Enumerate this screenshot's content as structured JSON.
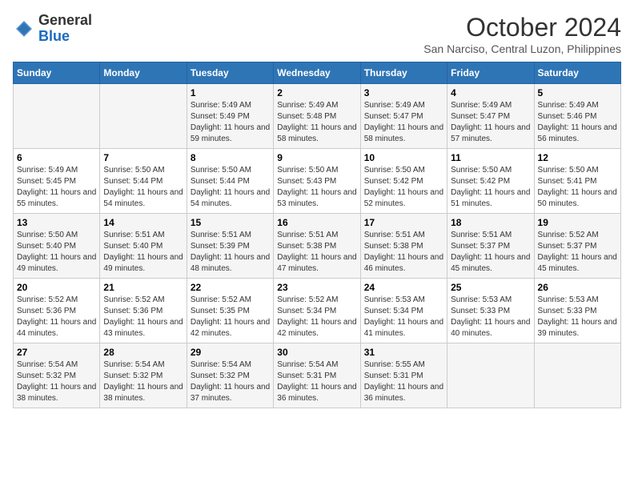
{
  "header": {
    "logo_general": "General",
    "logo_blue": "Blue",
    "month_title": "October 2024",
    "location": "San Narciso, Central Luzon, Philippines"
  },
  "days_of_week": [
    "Sunday",
    "Monday",
    "Tuesday",
    "Wednesday",
    "Thursday",
    "Friday",
    "Saturday"
  ],
  "weeks": [
    [
      {
        "day": "",
        "sunrise": "",
        "sunset": "",
        "daylight": ""
      },
      {
        "day": "",
        "sunrise": "",
        "sunset": "",
        "daylight": ""
      },
      {
        "day": "1",
        "sunrise": "Sunrise: 5:49 AM",
        "sunset": "Sunset: 5:49 PM",
        "daylight": "Daylight: 11 hours and 59 minutes."
      },
      {
        "day": "2",
        "sunrise": "Sunrise: 5:49 AM",
        "sunset": "Sunset: 5:48 PM",
        "daylight": "Daylight: 11 hours and 58 minutes."
      },
      {
        "day": "3",
        "sunrise": "Sunrise: 5:49 AM",
        "sunset": "Sunset: 5:47 PM",
        "daylight": "Daylight: 11 hours and 58 minutes."
      },
      {
        "day": "4",
        "sunrise": "Sunrise: 5:49 AM",
        "sunset": "Sunset: 5:47 PM",
        "daylight": "Daylight: 11 hours and 57 minutes."
      },
      {
        "day": "5",
        "sunrise": "Sunrise: 5:49 AM",
        "sunset": "Sunset: 5:46 PM",
        "daylight": "Daylight: 11 hours and 56 minutes."
      }
    ],
    [
      {
        "day": "6",
        "sunrise": "Sunrise: 5:49 AM",
        "sunset": "Sunset: 5:45 PM",
        "daylight": "Daylight: 11 hours and 55 minutes."
      },
      {
        "day": "7",
        "sunrise": "Sunrise: 5:50 AM",
        "sunset": "Sunset: 5:44 PM",
        "daylight": "Daylight: 11 hours and 54 minutes."
      },
      {
        "day": "8",
        "sunrise": "Sunrise: 5:50 AM",
        "sunset": "Sunset: 5:44 PM",
        "daylight": "Daylight: 11 hours and 54 minutes."
      },
      {
        "day": "9",
        "sunrise": "Sunrise: 5:50 AM",
        "sunset": "Sunset: 5:43 PM",
        "daylight": "Daylight: 11 hours and 53 minutes."
      },
      {
        "day": "10",
        "sunrise": "Sunrise: 5:50 AM",
        "sunset": "Sunset: 5:42 PM",
        "daylight": "Daylight: 11 hours and 52 minutes."
      },
      {
        "day": "11",
        "sunrise": "Sunrise: 5:50 AM",
        "sunset": "Sunset: 5:42 PM",
        "daylight": "Daylight: 11 hours and 51 minutes."
      },
      {
        "day": "12",
        "sunrise": "Sunrise: 5:50 AM",
        "sunset": "Sunset: 5:41 PM",
        "daylight": "Daylight: 11 hours and 50 minutes."
      }
    ],
    [
      {
        "day": "13",
        "sunrise": "Sunrise: 5:50 AM",
        "sunset": "Sunset: 5:40 PM",
        "daylight": "Daylight: 11 hours and 49 minutes."
      },
      {
        "day": "14",
        "sunrise": "Sunrise: 5:51 AM",
        "sunset": "Sunset: 5:40 PM",
        "daylight": "Daylight: 11 hours and 49 minutes."
      },
      {
        "day": "15",
        "sunrise": "Sunrise: 5:51 AM",
        "sunset": "Sunset: 5:39 PM",
        "daylight": "Daylight: 11 hours and 48 minutes."
      },
      {
        "day": "16",
        "sunrise": "Sunrise: 5:51 AM",
        "sunset": "Sunset: 5:38 PM",
        "daylight": "Daylight: 11 hours and 47 minutes."
      },
      {
        "day": "17",
        "sunrise": "Sunrise: 5:51 AM",
        "sunset": "Sunset: 5:38 PM",
        "daylight": "Daylight: 11 hours and 46 minutes."
      },
      {
        "day": "18",
        "sunrise": "Sunrise: 5:51 AM",
        "sunset": "Sunset: 5:37 PM",
        "daylight": "Daylight: 11 hours and 45 minutes."
      },
      {
        "day": "19",
        "sunrise": "Sunrise: 5:52 AM",
        "sunset": "Sunset: 5:37 PM",
        "daylight": "Daylight: 11 hours and 45 minutes."
      }
    ],
    [
      {
        "day": "20",
        "sunrise": "Sunrise: 5:52 AM",
        "sunset": "Sunset: 5:36 PM",
        "daylight": "Daylight: 11 hours and 44 minutes."
      },
      {
        "day": "21",
        "sunrise": "Sunrise: 5:52 AM",
        "sunset": "Sunset: 5:36 PM",
        "daylight": "Daylight: 11 hours and 43 minutes."
      },
      {
        "day": "22",
        "sunrise": "Sunrise: 5:52 AM",
        "sunset": "Sunset: 5:35 PM",
        "daylight": "Daylight: 11 hours and 42 minutes."
      },
      {
        "day": "23",
        "sunrise": "Sunrise: 5:52 AM",
        "sunset": "Sunset: 5:34 PM",
        "daylight": "Daylight: 11 hours and 42 minutes."
      },
      {
        "day": "24",
        "sunrise": "Sunrise: 5:53 AM",
        "sunset": "Sunset: 5:34 PM",
        "daylight": "Daylight: 11 hours and 41 minutes."
      },
      {
        "day": "25",
        "sunrise": "Sunrise: 5:53 AM",
        "sunset": "Sunset: 5:33 PM",
        "daylight": "Daylight: 11 hours and 40 minutes."
      },
      {
        "day": "26",
        "sunrise": "Sunrise: 5:53 AM",
        "sunset": "Sunset: 5:33 PM",
        "daylight": "Daylight: 11 hours and 39 minutes."
      }
    ],
    [
      {
        "day": "27",
        "sunrise": "Sunrise: 5:54 AM",
        "sunset": "Sunset: 5:32 PM",
        "daylight": "Daylight: 11 hours and 38 minutes."
      },
      {
        "day": "28",
        "sunrise": "Sunrise: 5:54 AM",
        "sunset": "Sunset: 5:32 PM",
        "daylight": "Daylight: 11 hours and 38 minutes."
      },
      {
        "day": "29",
        "sunrise": "Sunrise: 5:54 AM",
        "sunset": "Sunset: 5:32 PM",
        "daylight": "Daylight: 11 hours and 37 minutes."
      },
      {
        "day": "30",
        "sunrise": "Sunrise: 5:54 AM",
        "sunset": "Sunset: 5:31 PM",
        "daylight": "Daylight: 11 hours and 36 minutes."
      },
      {
        "day": "31",
        "sunrise": "Sunrise: 5:55 AM",
        "sunset": "Sunset: 5:31 PM",
        "daylight": "Daylight: 11 hours and 36 minutes."
      },
      {
        "day": "",
        "sunrise": "",
        "sunset": "",
        "daylight": ""
      },
      {
        "day": "",
        "sunrise": "",
        "sunset": "",
        "daylight": ""
      }
    ]
  ]
}
